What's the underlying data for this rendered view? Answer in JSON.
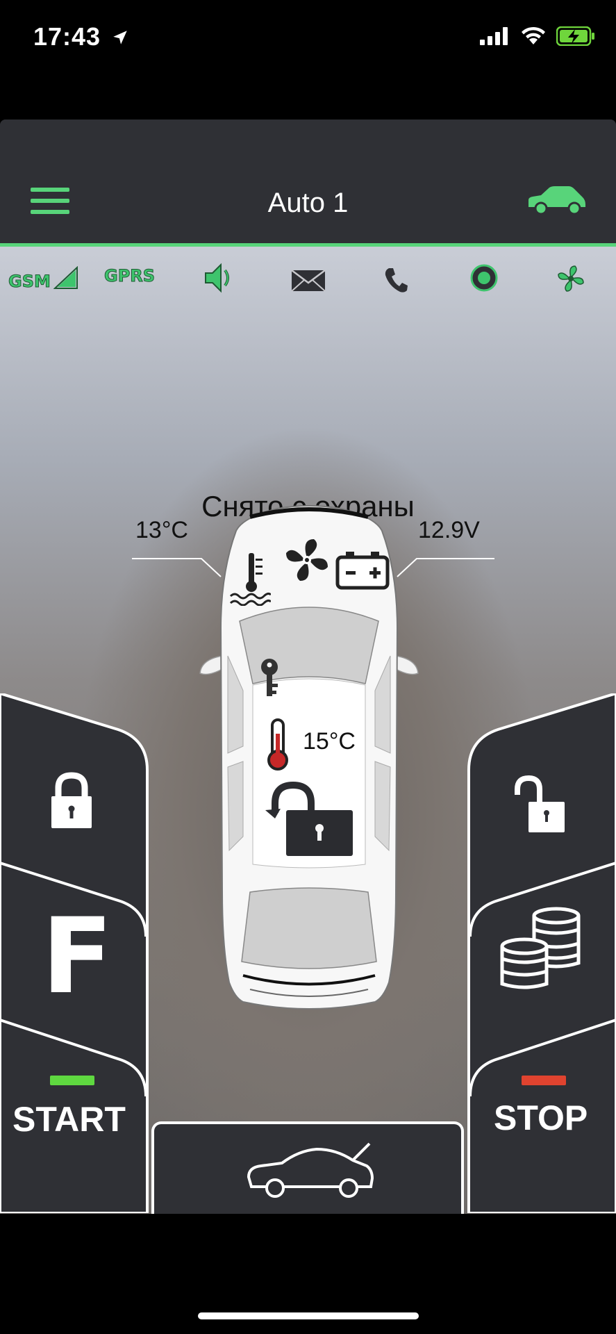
{
  "status_bar": {
    "time": "17:43"
  },
  "header": {
    "title": "Auto 1"
  },
  "indicators": {
    "gsm": "GSM",
    "gprs": "GPRS"
  },
  "state": {
    "text": "Снято с охраны"
  },
  "readings": {
    "engine_temp": "13°C",
    "voltage": "12.9V",
    "cabin_temp": "15°C"
  },
  "buttons": {
    "start_label": "START",
    "stop_label": "STOP",
    "f_label": "F"
  },
  "colors": {
    "accent": "#58d47a",
    "panel": "#2f3035",
    "start_led": "#5fd840",
    "stop_led": "#e0432f"
  }
}
